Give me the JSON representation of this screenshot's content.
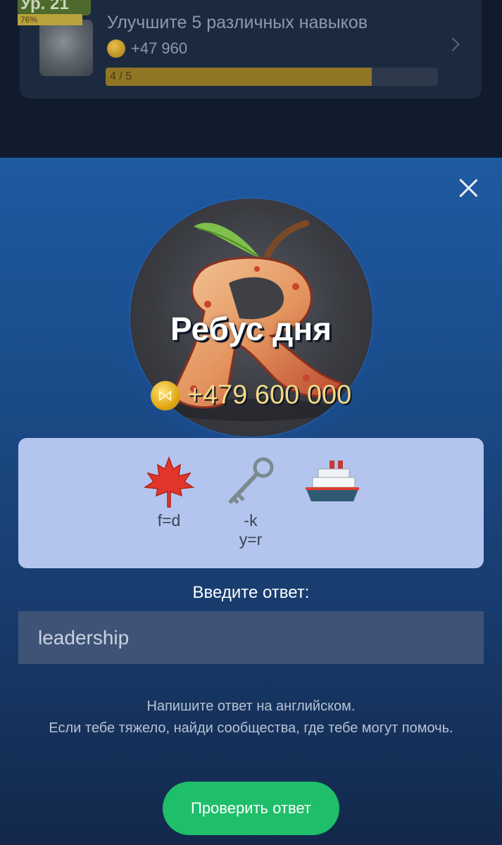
{
  "background": {
    "level_badge": "Ур. 21",
    "level_percent": "76%",
    "task_title": "Улучшите 5 различных навыков",
    "task_reward": "+47 960",
    "task_progress_text": "4 / 5",
    "task_progress": 0.8
  },
  "modal": {
    "title": "Ребус дня",
    "reward": "+479 600 000",
    "rebus": [
      {
        "icon": "maple-leaf-icon",
        "hint": "f=d"
      },
      {
        "icon": "key-icon",
        "hint": "-k\ny=r"
      },
      {
        "icon": "ship-icon",
        "hint": ""
      }
    ],
    "answer_label": "Введите ответ:",
    "answer_value": "leadership",
    "help_text": "Напишите ответ на английском.\nЕсли тебе тяжело, найди сообщества, где тебе могут помочь.",
    "check_button": "Проверить ответ"
  },
  "colors": {
    "accent_green": "#1fbe6a",
    "coin_gold": "#e1a913",
    "panel_bg": "#b3c5ee"
  }
}
